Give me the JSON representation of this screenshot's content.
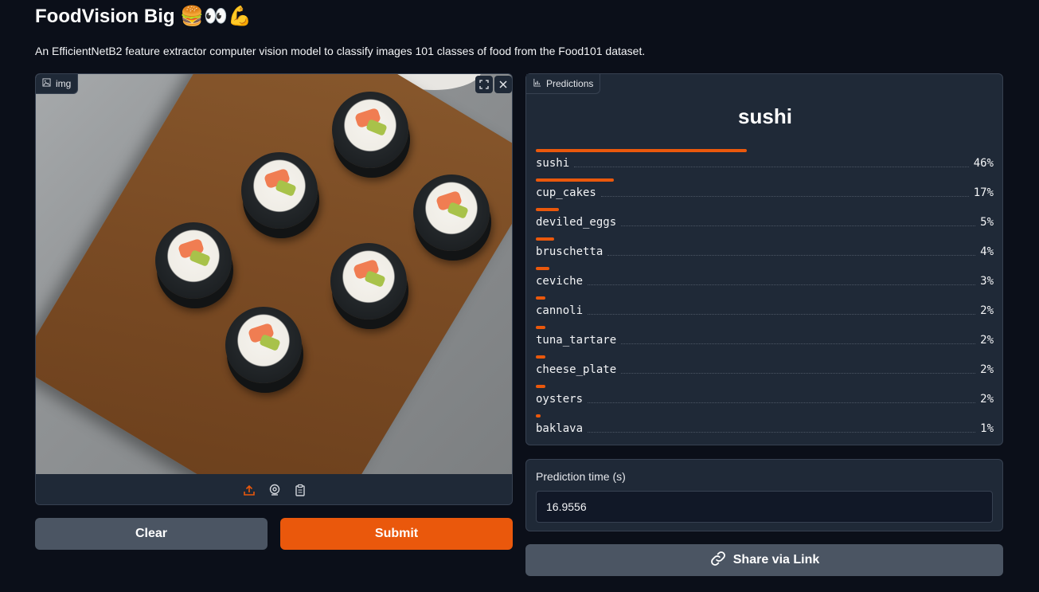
{
  "header": {
    "title": "FoodVision Big 🍔👀💪",
    "description": "An EfficientNetB2 feature extractor computer vision model to classify images 101 classes of food from the Food101 dataset."
  },
  "image_input": {
    "label": "img",
    "icons": [
      "image-icon",
      "fullscreen-icon",
      "close-icon",
      "upload-icon",
      "webcam-icon",
      "clipboard-icon"
    ]
  },
  "buttons": {
    "clear": "Clear",
    "submit": "Submit",
    "share": "Share via Link"
  },
  "predictions": {
    "label": "Predictions",
    "top_label": "sushi",
    "items": [
      {
        "label": "sushi",
        "percent": "46%",
        "value": 0.46
      },
      {
        "label": "cup_cakes",
        "percent": "17%",
        "value": 0.17
      },
      {
        "label": "deviled_eggs",
        "percent": "5%",
        "value": 0.05
      },
      {
        "label": "bruschetta",
        "percent": "4%",
        "value": 0.04
      },
      {
        "label": "ceviche",
        "percent": "3%",
        "value": 0.03
      },
      {
        "label": "cannoli",
        "percent": "2%",
        "value": 0.02
      },
      {
        "label": "tuna_tartare",
        "percent": "2%",
        "value": 0.02
      },
      {
        "label": "cheese_plate",
        "percent": "2%",
        "value": 0.02
      },
      {
        "label": "oysters",
        "percent": "2%",
        "value": 0.02
      },
      {
        "label": "baklava",
        "percent": "1%",
        "value": 0.01
      }
    ]
  },
  "prediction_time": {
    "label": "Prediction time (s)",
    "value": "16.9556"
  },
  "colors": {
    "accent": "#ea580c",
    "background": "#0b0f19",
    "panel": "#1f2937"
  }
}
